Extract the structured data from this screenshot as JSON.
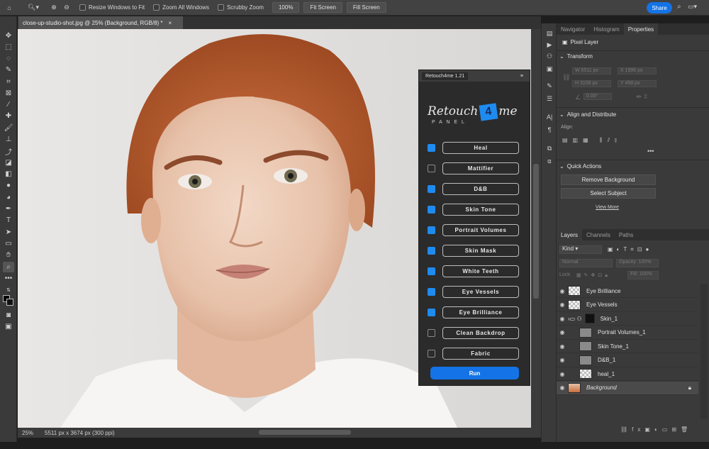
{
  "options_bar": {
    "resize_label": "Resize Windows to Fit",
    "zoom_all_label": "Zoom All Windows",
    "scrubby_label": "Scrubby Zoom",
    "zoom_100": "100%",
    "fit_screen": "Fit Screen",
    "fill_screen": "Fill Screen",
    "share": "Share"
  },
  "document": {
    "tab_title": "close-up-studio-shot.jpg @ 25% (Background, RGB/8) *",
    "close": "×",
    "zoom": "25%",
    "info": "5511 px x 3674 px (300 ppi)"
  },
  "plugin": {
    "title": "Retouch4me 1.21",
    "logo_text": "Retouch",
    "logo_badge": "4",
    "logo_suffix": "me",
    "logo_sub": "P A N E L",
    "items": [
      {
        "label": "Heal",
        "checked": true
      },
      {
        "label": "Mattifier",
        "checked": false
      },
      {
        "label": "D&B",
        "checked": true
      },
      {
        "label": "Skin Tone",
        "checked": true
      },
      {
        "label": "Portrait Volumes",
        "checked": true
      },
      {
        "label": "Skin Mask",
        "checked": true
      },
      {
        "label": "White Teeth",
        "checked": true
      },
      {
        "label": "Eye Vessels",
        "checked": true
      },
      {
        "label": "Eye Brilliance",
        "checked": true
      },
      {
        "label": "Clean Backdrop",
        "checked": false
      },
      {
        "label": "Fabric",
        "checked": false
      }
    ],
    "run": "Run"
  },
  "properties": {
    "tabs": [
      "Navigator",
      "Histogram",
      "Properties"
    ],
    "kind": "Pixel Layer",
    "transform_title": "Transform",
    "w": "W 5511 px",
    "x": "X 1996 px",
    "h": "H 3158 px",
    "y": "Y 458 px",
    "angle": "0.00°",
    "align_title": "Align and Distribute",
    "align_label": "Align:",
    "qa_title": "Quick Actions",
    "remove_bg": "Remove Background",
    "select_subject": "Select Subject",
    "view_more": "View More"
  },
  "layers": {
    "tabs": [
      "Layers",
      "Channels",
      "Paths"
    ],
    "filter": "Kind",
    "blend": "Normal",
    "opacity": "Opacity: 100%",
    "lock": "Lock:",
    "fill": "Fill: 100%",
    "items": [
      {
        "name": "Eye Brilliance",
        "indent": false,
        "thumb": "checker"
      },
      {
        "name": "Eye Vessels",
        "indent": false,
        "thumb": "checker"
      },
      {
        "name": "Skin_1",
        "indent": false,
        "thumb": "group"
      },
      {
        "name": "Portrait Volumes_1",
        "indent": true,
        "thumb": "gray"
      },
      {
        "name": "Skin Tone_1",
        "indent": true,
        "thumb": "gray"
      },
      {
        "name": "D&B_1",
        "indent": true,
        "thumb": "gray"
      },
      {
        "name": "heal_1",
        "indent": true,
        "thumb": "checker"
      },
      {
        "name": "Background",
        "indent": false,
        "thumb": "photo"
      }
    ]
  }
}
